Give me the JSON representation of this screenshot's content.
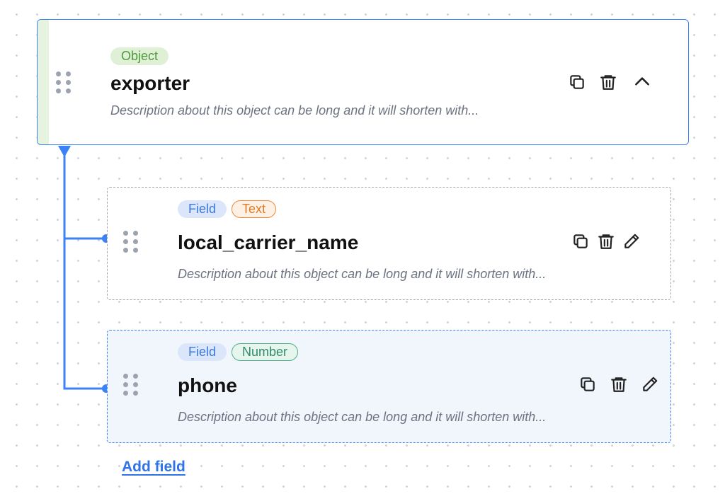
{
  "object": {
    "badge": "Object",
    "title": "exporter",
    "description": "Description about this object can be long and it will shorten with...",
    "actions": [
      "copy-icon",
      "trash-icon",
      "chevron-up-icon"
    ]
  },
  "fields": [
    {
      "badge": "Field",
      "type": "Text",
      "title": "local_carrier_name",
      "description": "Description about this object can be long and it will shorten with...",
      "actions": [
        "copy-icon",
        "trash-icon",
        "pencil-icon"
      ]
    },
    {
      "badge": "Field",
      "type": "Number",
      "title": "phone",
      "description": "Description about this object can be long and it will shorten with...",
      "actions": [
        "copy-icon",
        "trash-icon",
        "pencil-icon"
      ],
      "selected": true
    }
  ],
  "add_field_label": "Add field",
  "colors": {
    "accent": "#3b82f6",
    "object_badge": "#4e9b3a",
    "field_badge": "#3c78d8",
    "text_badge": "#e07a23",
    "number_badge": "#2f8c64"
  }
}
